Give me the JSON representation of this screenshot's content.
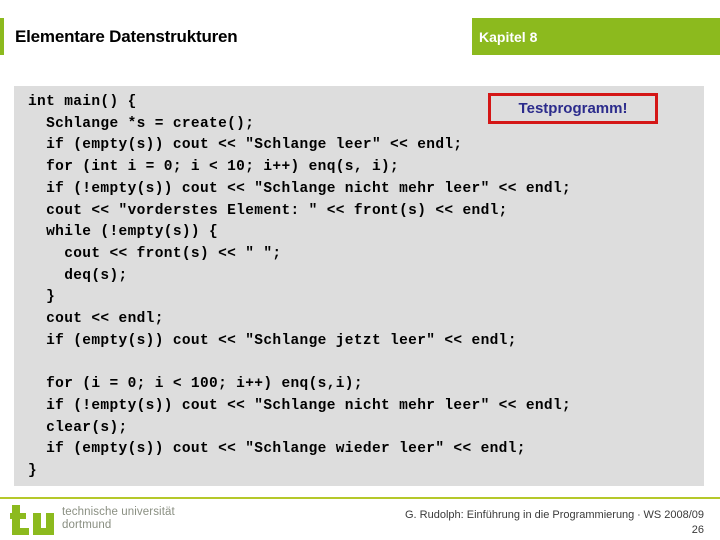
{
  "header": {
    "title": "Elementare Datenstrukturen",
    "chapter": "Kapitel 8",
    "bar_color": "#8cba1e"
  },
  "callout": {
    "label": "Testprogramm!",
    "border_color": "#d41616",
    "text_color": "#2c2c8c"
  },
  "code": {
    "background_color": "#dddddd",
    "lines": [
      "int main() {",
      "  Schlange *s = create();",
      "  if (empty(s)) cout << \"Schlange leer\" << endl;",
      "  for (int i = 0; i < 10; i++) enq(s, i);",
      "  if (!empty(s)) cout << \"Schlange nicht mehr leer\" << endl;",
      "  cout << \"vorderstes Element: \" << front(s) << endl;",
      "  while (!empty(s)) {",
      "    cout << front(s) << \" \";",
      "    deq(s);",
      "  }",
      "  cout << endl;",
      "  if (empty(s)) cout << \"Schlange jetzt leer\" << endl;",
      "",
      "  for (i = 0; i < 100; i++) enq(s,i);",
      "  if (!empty(s)) cout << \"Schlange nicht mehr leer\" << endl;",
      "  clear(s);",
      "  if (empty(s)) cout << \"Schlange wieder leer\" << endl;",
      "}"
    ]
  },
  "footer": {
    "logo_line1": "technische universität",
    "logo_line2": "dortmund",
    "logo_color": "#8cba1e",
    "credit": "G. Rudolph: Einführung in die Programmierung ∙ WS 2008/09",
    "page_number": "26",
    "rule_color": "#b5c82a"
  }
}
